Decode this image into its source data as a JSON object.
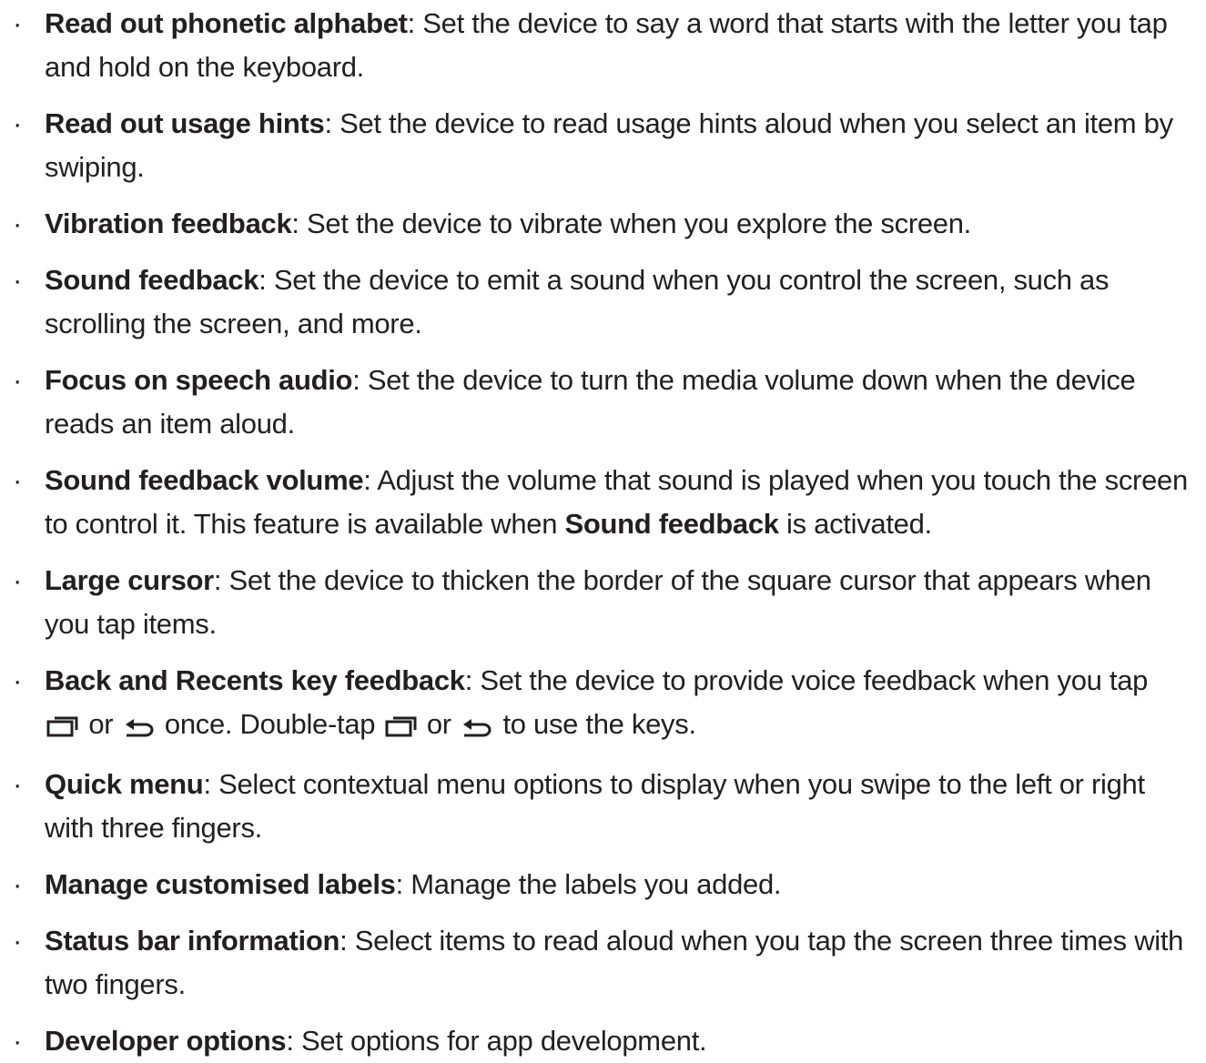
{
  "items": [
    {
      "term": "Read out phonetic alphabet",
      "text": ": Set the device to say a word that starts with the letter you tap and hold on the keyboard."
    },
    {
      "term": "Read out usage hints",
      "text": ": Set the device to read usage hints aloud when you select an item by swiping."
    },
    {
      "term": "Vibration feedback",
      "text": ": Set the device to vibrate when you explore the screen."
    },
    {
      "term": "Sound feedback",
      "text": ": Set the device to emit a sound when you control the screen, such as scrolling the screen, and more."
    },
    {
      "term": "Focus on speech audio",
      "text": ": Set the device to turn the media volume down when the device reads an item aloud."
    },
    {
      "term": "Sound feedback volume",
      "text": ": Adjust the volume that sound is played when you touch the screen to control it. This feature is available when ",
      "bold2": "Sound feedback",
      "text2": " is activated."
    },
    {
      "term": "Large cursor",
      "text": ": Set the device to thicken the border of the square cursor that appears when you tap items."
    },
    {
      "term": "Back and Recents key feedback",
      "text": ": Set the device to provide voice feedback when you tap",
      "or1": " or ",
      "mid": " once. Double-tap ",
      "or2": " or ",
      "end": " to use the keys."
    },
    {
      "term": "Quick menu",
      "text": ": Select contextual menu options to display when you swipe to the left or right with three fingers."
    },
    {
      "term": "Manage customised labels",
      "text": ": Manage the labels you added."
    },
    {
      "term": "Status bar information",
      "text": ": Select items to read aloud when you tap the screen three times with two fingers."
    },
    {
      "term": "Developer options",
      "text": ": Set options for app development."
    }
  ],
  "bullet_char": "·",
  "icons": {
    "recents": "recents-key-icon",
    "back": "back-key-icon"
  }
}
